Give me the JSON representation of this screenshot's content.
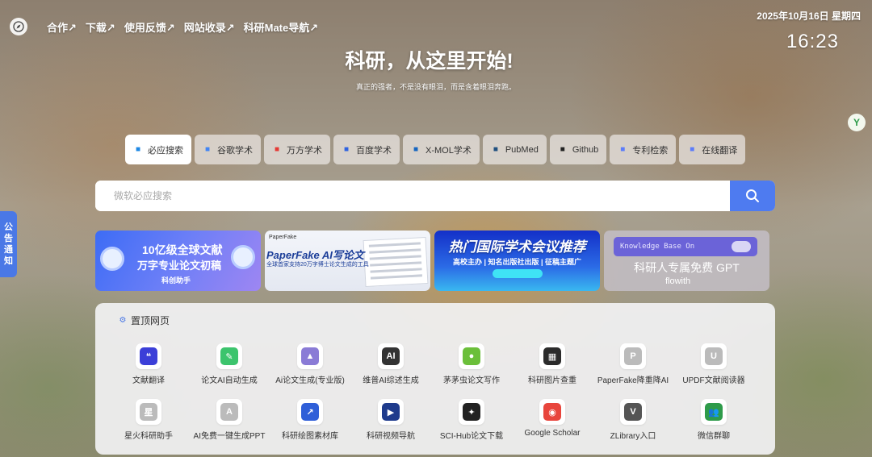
{
  "nav": {
    "links": [
      "合作↗",
      "下载↗",
      "使用反馈↗",
      "网站收录↗",
      "科研Mate导航↗"
    ]
  },
  "clock": {
    "date": "2025年10月16日 星期四",
    "time": "16:23"
  },
  "hero": {
    "title": "科研，从这里开始!",
    "subtitle": "真正的强者，不是没有眼泪，而是含着眼泪奔跑。"
  },
  "side_tab": {
    "label": "公告通知"
  },
  "right_badge": {
    "label": "Y"
  },
  "engines": [
    {
      "label": "必应搜索",
      "icon": "bing-icon",
      "color": "#1e88e5"
    },
    {
      "label": "谷歌学术",
      "icon": "google-scholar-icon",
      "color": "#4285f4"
    },
    {
      "label": "万方学术",
      "icon": "wanfang-icon",
      "color": "#e53935"
    },
    {
      "label": "百度学术",
      "icon": "baidu-icon",
      "color": "#2f63e0"
    },
    {
      "label": "X-MOL学术",
      "icon": "xmol-icon",
      "color": "#1565c0"
    },
    {
      "label": "PubMed",
      "icon": "pubmed-icon",
      "color": "#20507f"
    },
    {
      "label": "Github",
      "icon": "github-icon",
      "color": "#222222"
    },
    {
      "label": "专利检索",
      "icon": "patent-icon",
      "color": "#5c7cfa"
    },
    {
      "label": "在线翻译",
      "icon": "translate-icon",
      "color": "#5c7cfa"
    }
  ],
  "search": {
    "placeholder": "微软必应搜索"
  },
  "banners": {
    "b1": {
      "title": "10亿级全球文献",
      "subtitle": "万字专业论文初稿",
      "brand": "科创助手"
    },
    "b2": {
      "logo": "PaperFake",
      "title": "PaperFake AI写论文",
      "subtitle": "全球首家支持20万字博士论文生成的工具"
    },
    "b3": {
      "title": "热门国际学术会议推荐",
      "subtitle": "高校主办 | 知名出版社出版 | 征稿主题广"
    },
    "b4": {
      "bar": "Knowledge Base On",
      "title": "科研人专属免费 GPT",
      "brand": "flowith"
    }
  },
  "pinned": {
    "title": "置顶网页",
    "items": [
      {
        "label": "文献翻译",
        "icon": "quote-icon",
        "color": "#3b3fd8",
        "glyph": "❝"
      },
      {
        "label": "论文AI自动生成",
        "icon": "leaf-icon",
        "color": "#3cc46d",
        "glyph": "✎"
      },
      {
        "label": "Ai论文生成(专业版)",
        "icon": "aipaper-icon",
        "color": "#8a7bd6",
        "glyph": "▲"
      },
      {
        "label": "维普AI综述生成",
        "icon": "ai-chip-icon",
        "color": "#333333",
        "glyph": "AI"
      },
      {
        "label": "茅茅虫论文写作",
        "icon": "caterpillar-icon",
        "color": "#6bbf3a",
        "glyph": "●"
      },
      {
        "label": "科研图片查重",
        "icon": "image-check-icon",
        "color": "#2b2b2b",
        "glyph": "▦"
      },
      {
        "label": "PaperFake降重降AI",
        "icon": "paperfake-icon",
        "color": "#bbbbbb",
        "glyph": "P"
      },
      {
        "label": "UPDF文献阅读器",
        "icon": "updf-icon",
        "color": "#bbbbbb",
        "glyph": "U"
      },
      {
        "label": "星火科研助手",
        "icon": "spark-icon",
        "color": "#bbbbbb",
        "glyph": "星"
      },
      {
        "label": "AI免费一键生成PPT",
        "icon": "ppt-icon",
        "color": "#bbbbbb",
        "glyph": "A"
      },
      {
        "label": "科研绘图素材库",
        "icon": "chart-line-icon",
        "color": "#2f5fd8",
        "glyph": "↗"
      },
      {
        "label": "科研视频导航",
        "icon": "video-icon",
        "color": "#1f3b8c",
        "glyph": "▶"
      },
      {
        "label": "SCI-Hub论文下载",
        "icon": "raven-icon",
        "color": "#222222",
        "glyph": "✦"
      },
      {
        "label": "Google Scholar",
        "icon": "chrome-icon",
        "color": "#e8453c",
        "glyph": "◉"
      },
      {
        "label": "ZLibrary入口",
        "icon": "zlibrary-icon",
        "color": "#555555",
        "glyph": "V"
      },
      {
        "label": "微信群聊",
        "icon": "wechat-group-icon",
        "color": "#2e9b4a",
        "glyph": "👥"
      }
    ]
  },
  "colors": {
    "accent": "#4e7bf0",
    "side_tab": "#4a78e6"
  }
}
